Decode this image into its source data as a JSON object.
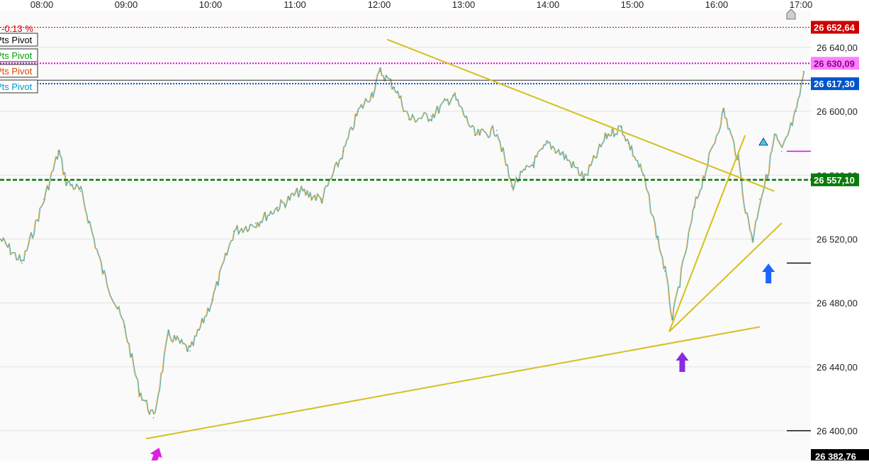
{
  "chart_data": {
    "type": "line",
    "title": "",
    "xlabel": "",
    "ylabel": "",
    "x_ticks": [
      "08:00",
      "09:00",
      "10:00",
      "11:00",
      "12:00",
      "13:00",
      "14:00",
      "15:00",
      "16:00",
      "17:00"
    ],
    "y_ticks": [
      "26 640,00",
      "26 600,00",
      "26 560,00",
      "26 520,00",
      "26 480,00",
      "26 440,00",
      "26 400,00"
    ],
    "ylim": [
      26382.76,
      26660.0
    ],
    "xlim": [
      "07:50",
      "17:05"
    ],
    "grid": true,
    "series": [
      {
        "color": "#2ea3b8",
        "x": [
          "07:50",
          "08:05",
          "08:20",
          "08:30",
          "08:35",
          "08:45",
          "09:00",
          "09:15",
          "09:25",
          "09:35",
          "09:45",
          "10:00",
          "10:15",
          "10:30",
          "10:45",
          "11:00",
          "11:15",
          "11:30",
          "11:45",
          "11:55",
          "12:05",
          "12:10",
          "12:20",
          "12:30",
          "12:45",
          "13:00",
          "13:15",
          "13:30",
          "13:40",
          "13:55",
          "14:05",
          "14:15",
          "14:30",
          "14:45",
          "14:55",
          "15:00",
          "15:10",
          "15:20",
          "15:25",
          "15:30",
          "15:45",
          "15:55",
          "16:05",
          "16:15",
          "16:20",
          "16:25",
          "16:30",
          "16:35",
          "16:40",
          "16:45",
          "16:55",
          "17:00"
        ],
        "y": [
          26520,
          26505,
          26545,
          26575,
          26556,
          26550,
          26500,
          26465,
          26425,
          26408,
          26460,
          26450,
          26482,
          26525,
          26530,
          26540,
          26550,
          26545,
          26575,
          26600,
          26612,
          26625,
          26615,
          26595,
          26597,
          26610,
          26585,
          26588,
          26553,
          26568,
          26580,
          26573,
          26558,
          26585,
          26590,
          26580,
          26560,
          26520,
          26500,
          26470,
          26540,
          26570,
          26600,
          26570,
          26538,
          26520,
          26545,
          26560,
          26585,
          26575,
          26600,
          26625
        ]
      }
    ],
    "levels": [
      {
        "label": "26 652,64",
        "value": 26652.64,
        "color": "#cc0000",
        "style": "dotted"
      },
      {
        "label": "26 630,09",
        "value": 26630.09,
        "color": "#e000e0",
        "style": "dotted"
      },
      {
        "label": "26 617,30",
        "value": 26617.3,
        "color": "#0055cc",
        "style": "dotted"
      },
      {
        "label": "26 557,10",
        "value": 26557.1,
        "color": "#0a7a0a",
        "style": "dashed"
      }
    ],
    "trendlines": [
      {
        "from": [
          "09:30",
          26395
        ],
        "to": [
          "16:30",
          26465
        ]
      },
      {
        "from": [
          "12:15",
          26645
        ],
        "to": [
          "16:40",
          26550
        ]
      },
      {
        "from": [
          "15:28",
          26462
        ],
        "to": [
          "16:20",
          26585
        ]
      },
      {
        "from": [
          "15:28",
          26462
        ],
        "to": [
          "16:45",
          26530
        ]
      }
    ],
    "markers": [
      {
        "name": "magenta-arrow",
        "color": "#e020e0",
        "x": "09:35"
      },
      {
        "name": "purple-arrow",
        "color": "#8a2be2",
        "x": "15:35"
      },
      {
        "name": "blue-arrow",
        "color": "#1a66ff",
        "x": "16:35"
      }
    ],
    "bottom_label": "26 382,76",
    "pct_change": "-0.13 %",
    "pivot_labels": [
      {
        "text": "Pts Pivot",
        "color": "#000000"
      },
      {
        "text": "Pts Pivot",
        "color": "#00a000"
      },
      {
        "text": "Pts Pivot",
        "color": "#e04000"
      },
      {
        "text": "Pts Pivot",
        "color": "#0099cc"
      }
    ]
  }
}
